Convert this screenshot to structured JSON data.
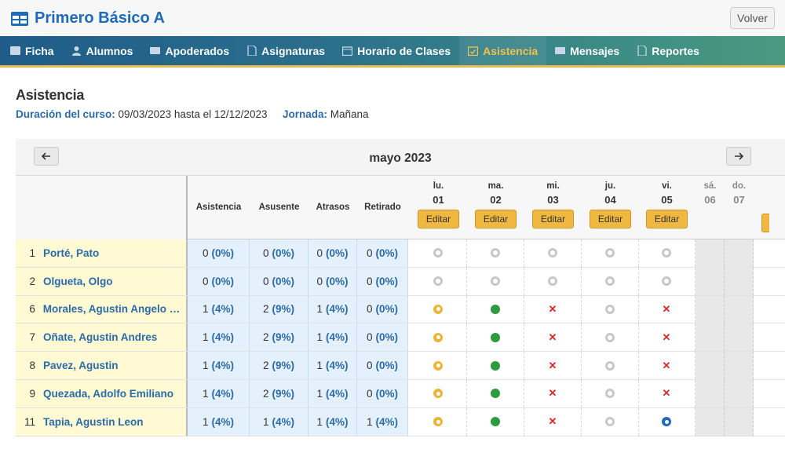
{
  "header": {
    "title": "Primero Básico A",
    "back_label": "Volver"
  },
  "nav": {
    "items": [
      {
        "label": "Ficha",
        "icon": "table-icon"
      },
      {
        "label": "Alumnos",
        "icon": "user-icon"
      },
      {
        "label": "Apoderados",
        "icon": "id-card-icon"
      },
      {
        "label": "Asignaturas",
        "icon": "file-icon"
      },
      {
        "label": "Horario de Clases",
        "icon": "calendar-icon"
      },
      {
        "label": "Asistencia",
        "icon": "calendar-check-icon"
      },
      {
        "label": "Mensajes",
        "icon": "envelope-icon"
      },
      {
        "label": "Reportes",
        "icon": "report-icon"
      }
    ],
    "active_index": 5
  },
  "section": {
    "title": "Asistencia",
    "duration_label": "Duración del curso:",
    "duration_value": "09/03/2023 hasta el 12/12/2023",
    "shift_label": "Jornada:",
    "shift_value": "Mañana"
  },
  "calendar": {
    "month": "mayo 2023",
    "stat_columns": [
      "Asistencia",
      "Asusente",
      "Atrasos",
      "Retirado"
    ],
    "edit_label": "Editar",
    "days": [
      {
        "dow": "lu.",
        "num": "01",
        "weekend": false
      },
      {
        "dow": "ma.",
        "num": "02",
        "weekend": false
      },
      {
        "dow": "mi.",
        "num": "03",
        "weekend": false
      },
      {
        "dow": "ju.",
        "num": "04",
        "weekend": false
      },
      {
        "dow": "vi.",
        "num": "05",
        "weekend": false
      },
      {
        "dow": "sá.",
        "num": "06",
        "weekend": true
      },
      {
        "dow": "do.",
        "num": "07",
        "weekend": true
      }
    ]
  },
  "students": [
    {
      "idx": "1",
      "name": "Porté, Pato",
      "stats": [
        [
          "0",
          "(0%)"
        ],
        [
          "0",
          "(0%)"
        ],
        [
          "0",
          "(0%)"
        ],
        [
          "0",
          "(0%)"
        ]
      ],
      "marks": [
        "unset",
        "unset",
        "unset",
        "unset",
        "unset"
      ]
    },
    {
      "idx": "2",
      "name": "Olgueta, Olgo",
      "stats": [
        [
          "0",
          "(0%)"
        ],
        [
          "0",
          "(0%)"
        ],
        [
          "0",
          "(0%)"
        ],
        [
          "0",
          "(0%)"
        ]
      ],
      "marks": [
        "unset",
        "unset",
        "unset",
        "unset",
        "unset"
      ]
    },
    {
      "idx": "6",
      "name": "Morales, Agustin Angelo M...",
      "stats": [
        [
          "1",
          "(4%)"
        ],
        [
          "2",
          "(9%)"
        ],
        [
          "1",
          "(4%)"
        ],
        [
          "0",
          "(0%)"
        ]
      ],
      "marks": [
        "late",
        "present",
        "absent",
        "unset",
        "absent"
      ]
    },
    {
      "idx": "7",
      "name": "Oñate, Agustin Andres",
      "stats": [
        [
          "1",
          "(4%)"
        ],
        [
          "2",
          "(9%)"
        ],
        [
          "1",
          "(4%)"
        ],
        [
          "0",
          "(0%)"
        ]
      ],
      "marks": [
        "late",
        "present",
        "absent",
        "unset",
        "absent"
      ]
    },
    {
      "idx": "8",
      "name": "Pavez, Agustin",
      "stats": [
        [
          "1",
          "(4%)"
        ],
        [
          "2",
          "(9%)"
        ],
        [
          "1",
          "(4%)"
        ],
        [
          "0",
          "(0%)"
        ]
      ],
      "marks": [
        "late",
        "present",
        "absent",
        "unset",
        "absent"
      ]
    },
    {
      "idx": "9",
      "name": "Quezada, Adolfo Emiliano",
      "stats": [
        [
          "1",
          "(4%)"
        ],
        [
          "2",
          "(9%)"
        ],
        [
          "1",
          "(4%)"
        ],
        [
          "0",
          "(0%)"
        ]
      ],
      "marks": [
        "late",
        "present",
        "absent",
        "unset",
        "absent"
      ]
    },
    {
      "idx": "11",
      "name": "Tapia, Agustin Leon",
      "stats": [
        [
          "1",
          "(4%)"
        ],
        [
          "1",
          "(4%)"
        ],
        [
          "1",
          "(4%)"
        ],
        [
          "1",
          "(4%)"
        ]
      ],
      "marks": [
        "late",
        "present",
        "absent",
        "unset",
        "retired"
      ]
    }
  ],
  "colors": {
    "brand": "#1e6bb8",
    "active_tab": "#f2c14e",
    "present": "#2e9a3e",
    "absent": "#d72a2a",
    "late": "#eab63a"
  }
}
